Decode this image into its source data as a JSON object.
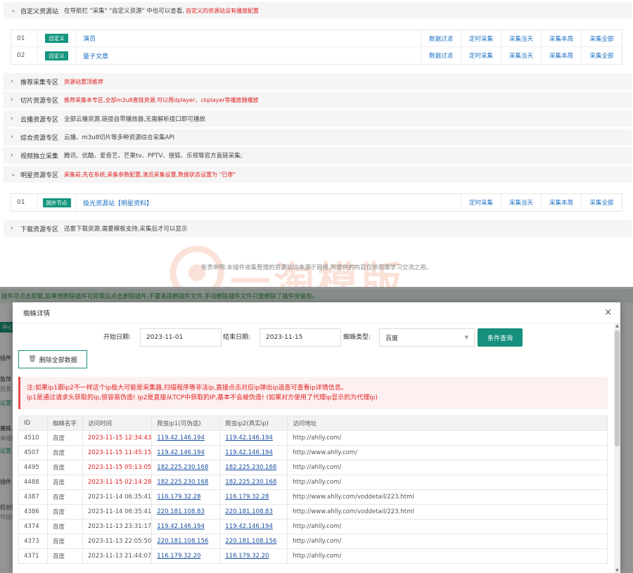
{
  "top_section": {
    "name": "自定义资源站",
    "desc_gray": "在导航栏 \"采集\" \"自定义资源\" 中也可以查看,",
    "desc_red": "自定义的资源站没有播放配置",
    "rows": [
      {
        "no": "01",
        "tag": "自定义",
        "name": "演员",
        "actions": [
          "数据过滤",
          "定时采集",
          "采集当天",
          "采集本周",
          "采集全部"
        ]
      },
      {
        "no": "02",
        "tag": "自定义",
        "name": "量子文章",
        "actions": [
          "数据过滤",
          "定时采集",
          "采集当天",
          "采集本周",
          "采集全部"
        ]
      }
    ]
  },
  "sections": [
    {
      "name": "推荐采集专区",
      "desc": "资源站置顶推荐",
      "red": true
    },
    {
      "name": "切片资源专区",
      "desc": "推荐采集本专区,全部m3u8直链资源,可以用dplayer、ckplayer等播放器播放",
      "red": true
    },
    {
      "name": "云播资源专区",
      "desc": "全部云播资源,链接自带播放器,无需解析接口即可播放",
      "red": false
    },
    {
      "name": "综合资源专区",
      "desc": "云播、m3u8切片等多种资源综合采集API",
      "red": false
    },
    {
      "name": "视频独立采集",
      "desc": "腾讯、优酷、爱奇艺、芒果tv、PPTV、搜狐、乐视等官方直链采集;",
      "red": false
    }
  ],
  "star_section": {
    "name": "明星资源专区",
    "desc": "采集前,先在系统,采集参数配置,演员采集设置,数据状态设置为 \"已审\"",
    "rows": [
      {
        "no": "01",
        "tag": "国外节点",
        "name": "极光资源站【明星资料】",
        "actions": [
          "定时采集",
          "采集当天",
          "采集本周",
          "采集全部"
        ]
      }
    ]
  },
  "download_section": {
    "name": "下载资源专区",
    "desc": "迅雷下载资源,需要模板支持,采集后才可以显示"
  },
  "footer_note": "免责申明:本插件收集整理的资源站均来源于网络,所提供的内容仅供观摩学习交流之用。",
  "watermark_text": "一淘模版",
  "warn_bar": "插件可点击卸载,如果想删除插件可卸载后点击删除插件,不要直接删插件文件,手动删除插件文件只是删除了插件安装包。",
  "left_stubs": [
    "中心",
    "插件",
    "笛萍",
    "百安…",
    "设置",
    "魔蛛…",
    "本插件",
    "设置",
    "插件",
    "后台整",
    "可自定"
  ],
  "modal": {
    "title": "蜘蛛详情",
    "close_icon": "×",
    "filters": {
      "start_label": "开始日期:",
      "start_value": "2023-11-01",
      "end_label": "结束日期:",
      "end_value": "2023-11-15",
      "type_label": "蜘蛛类型:",
      "type_value": "百度",
      "query_button": "条件查询"
    },
    "delete_button": "删除全部数据",
    "notice_line1": "注:如果ip1跟ip2不一样这个ip极大可能是采集器,扫描程序等非法ip,直接点击对应ip弹出ip追查可查看ip详情信息。",
    "notice_line2": "ip1是通过请求头获取的ip,很容易伪造! ip2是直接从TCP中获取的IP,基本不会被伪造! (如果对方使用了代理ip显示的为代理ip)",
    "columns": [
      "ID",
      "蜘蛛名字",
      "访问时间",
      "爬虫ip1(可伪造)",
      "爬虫ip2(真实ip)",
      "访问地址"
    ],
    "rows": [
      {
        "id": "4510",
        "name": "百度",
        "time": "2023-11-15 12:34:43",
        "ip1": "119.42.146.194",
        "ip2": "119.42.146.194",
        "url": "http://ahlly.com/",
        "today": true
      },
      {
        "id": "4507",
        "name": "百度",
        "time": "2023-11-15 11:45:15",
        "ip1": "119.42.146.194",
        "ip2": "119.42.146.194",
        "url": "http://www.ahlly.com/",
        "today": true
      },
      {
        "id": "4495",
        "name": "百度",
        "time": "2023-11-15 05:13:05",
        "ip1": "182.225.230.168",
        "ip2": "182.225.230.168",
        "url": "http://ahlly.com/",
        "today": true
      },
      {
        "id": "4488",
        "name": "百度",
        "time": "2023-11-15 02:14:28",
        "ip1": "182.225.230.168",
        "ip2": "182.225.230.168",
        "url": "http://ahlly.com/",
        "today": true
      },
      {
        "id": "4387",
        "name": "百度",
        "time": "2023-11-14 06:35:41",
        "ip1": "116.179.32.28",
        "ip2": "116.179.32.28",
        "url": "http://www.ahlly.com/voddetail/223.html",
        "today": false
      },
      {
        "id": "4386",
        "name": "百度",
        "time": "2023-11-14 06:35:41",
        "ip1": "220.181.108.83",
        "ip2": "220.181.108.83",
        "url": "http://www.ahlly.com/voddetail/223.html",
        "today": false
      },
      {
        "id": "4374",
        "name": "百度",
        "time": "2023-11-13 23:31:17",
        "ip1": "119.42.146.194",
        "ip2": "119.42.146.194",
        "url": "http://ahlly.com/",
        "today": false
      },
      {
        "id": "4373",
        "name": "百度",
        "time": "2023-11-13 22:05:50",
        "ip1": "220.181.108.156",
        "ip2": "220.181.108.156",
        "url": "http://ahlly.com/",
        "today": false
      },
      {
        "id": "4371",
        "name": "百度",
        "time": "2023-11-13 21:44:07",
        "ip1": "116.179.32.20",
        "ip2": "116.179.32.20",
        "url": "http://ahlly.com/",
        "today": false
      }
    ]
  }
}
